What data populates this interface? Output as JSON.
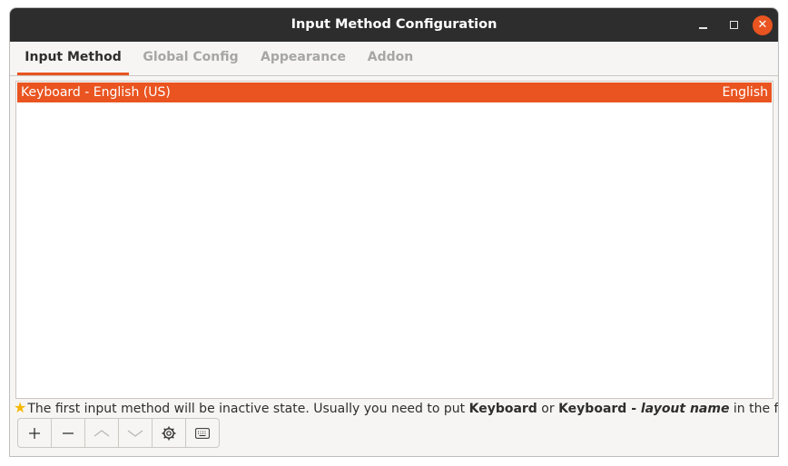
{
  "window": {
    "title": "Input Method Configuration"
  },
  "tabs": [
    {
      "label": "Input Method",
      "active": true
    },
    {
      "label": "Global Config",
      "active": false
    },
    {
      "label": "Appearance",
      "active": false
    },
    {
      "label": "Addon",
      "active": false
    }
  ],
  "input_methods": [
    {
      "name": "Keyboard - English (US)",
      "language": "English",
      "selected": true
    }
  ],
  "hint": {
    "prefix": "The first input method will be inactive state. Usually you need to put ",
    "kw1": "Keyboard",
    "mid": " or ",
    "kw2": "Keyboard - ",
    "kw2_italic": "layout name",
    "suffix": " in the first place."
  },
  "toolbar": {
    "buttons": [
      {
        "icon": "add-icon",
        "enabled": true
      },
      {
        "icon": "remove-icon",
        "enabled": true
      },
      {
        "icon": "move-up-icon",
        "enabled": false
      },
      {
        "icon": "move-down-icon",
        "enabled": false
      },
      {
        "icon": "configure-icon",
        "enabled": true
      },
      {
        "icon": "keyboard-layout-icon",
        "enabled": true
      }
    ]
  },
  "colors": {
    "accent": "#e95420",
    "titlebar": "#2d2d2d"
  }
}
